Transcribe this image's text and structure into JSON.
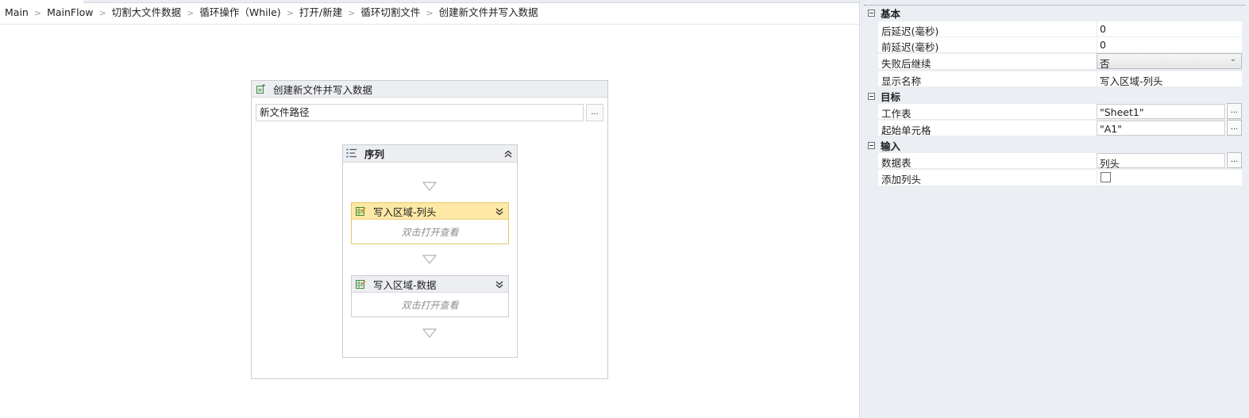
{
  "breadcrumb": [
    "Main",
    "MainFlow",
    "切割大文件数据",
    "循环操作（While)",
    "打开/新建",
    "循环切割文件",
    "创建新文件并写入数据"
  ],
  "outer_activity": {
    "title": "创建新文件并写入数据",
    "path_value": "新文件路径",
    "browse_label": "..."
  },
  "sequence": {
    "title": "序列",
    "activities": [
      {
        "title": "写入区域-列头",
        "hint": "双击打开查看",
        "selected": true
      },
      {
        "title": "写入区域-数据",
        "hint": "双击打开查看",
        "selected": false
      }
    ]
  },
  "properties": {
    "categories": [
      {
        "title": "基本",
        "rows": [
          {
            "name": "后延迟(毫秒)",
            "value": "0"
          },
          {
            "name": "前延迟(毫秒)",
            "value": "0"
          },
          {
            "name": "失败后继续",
            "value": "否"
          },
          {
            "name": "显示名称",
            "value": "写入区域-列头"
          }
        ]
      },
      {
        "title": "目标",
        "rows": [
          {
            "name": "工作表",
            "value": "\"Sheet1\"",
            "button": "..."
          },
          {
            "name": "起始单元格",
            "value": "\"A1\"",
            "button": "..."
          }
        ]
      },
      {
        "title": "输入",
        "rows": [
          {
            "name": "数据表",
            "value": "列头",
            "button": "..."
          },
          {
            "name": "添加列头",
            "value": "",
            "checked": false
          }
        ]
      }
    ]
  },
  "colors": {
    "selected_header": "#fde8a5",
    "selected_border": "#e6c56b",
    "panel_bg": "#ebeef2"
  }
}
